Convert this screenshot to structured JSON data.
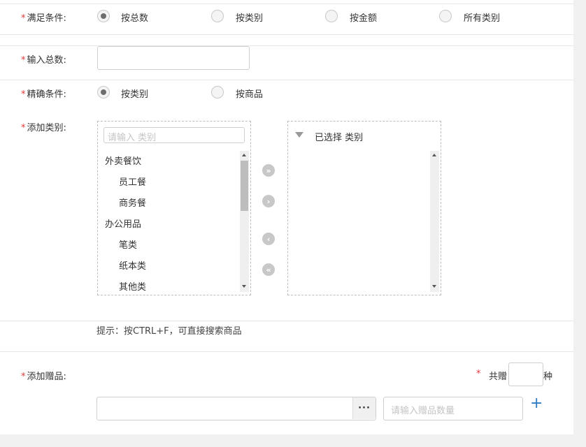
{
  "form": {
    "satisfy": {
      "required": "*",
      "label": "满足条件:",
      "options": [
        "按总数",
        "按类别",
        "按金额",
        "所有类别"
      ],
      "selected": "按总数"
    },
    "total": {
      "required": "*",
      "label": "输入总数:",
      "value": ""
    },
    "precise": {
      "required": "*",
      "label": "精确条件:",
      "options": [
        "按类别",
        "按商品"
      ],
      "selected": "按类别"
    },
    "add_category": {
      "required": "*",
      "label": "添加类别:",
      "search_placeholder": "请输入 类别",
      "tree": [
        {
          "label": "外卖餐饮",
          "level": 0
        },
        {
          "label": "员工餐",
          "level": 1
        },
        {
          "label": "商务餐",
          "level": 1
        },
        {
          "label": "办公用品",
          "level": 0
        },
        {
          "label": "笔类",
          "level": 1
        },
        {
          "label": "纸本类",
          "level": 1
        },
        {
          "label": "其他类",
          "level": 1
        }
      ],
      "selected_header": "已选择 类别",
      "transfer_buttons": {
        "move_all_right": "»",
        "move_right": "›",
        "move_left": "‹",
        "move_all_left": "«"
      }
    },
    "hint": "提示：按CTRL+F，可直接搜索商品",
    "add_gift": {
      "required": "*",
      "label": "添加赠品:",
      "total_required": "*",
      "total_prefix": "共赠",
      "total_value": "",
      "total_suffix": "种",
      "gift_value": "",
      "more_button": "···",
      "quantity_placeholder": "请输入赠品数量",
      "add_button": "+"
    }
  },
  "colors": {
    "required": "#e4393c",
    "add_icon": "#2f7cc3"
  }
}
